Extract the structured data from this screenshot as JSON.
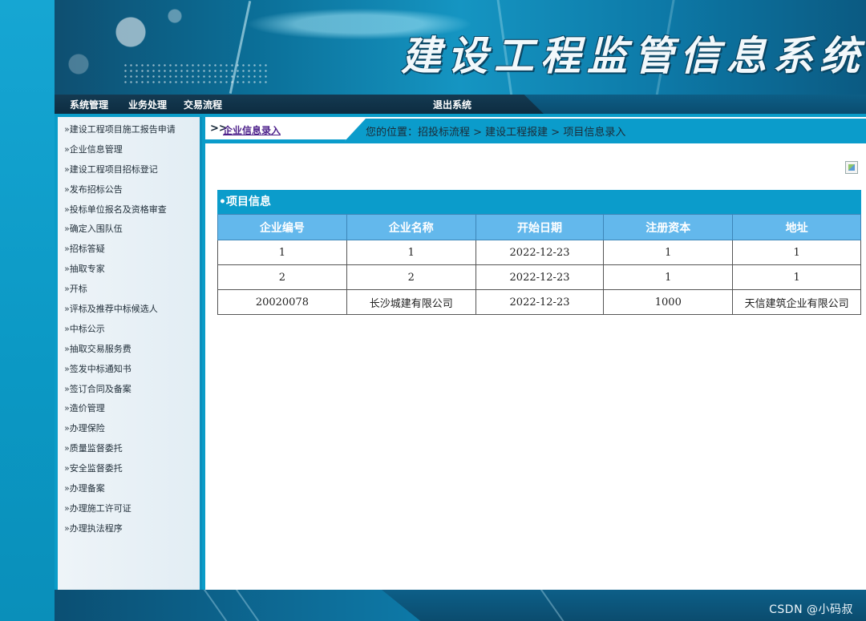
{
  "app": {
    "title": "建设工程监管信息系统"
  },
  "nav": {
    "items": [
      {
        "label": "系统管理"
      },
      {
        "label": "业务处理"
      },
      {
        "label": "交易流程"
      }
    ],
    "logout_label": "退出系统"
  },
  "sidebar": {
    "items": [
      {
        "label": "»建设工程项目施工报告申请"
      },
      {
        "label": "»企业信息管理"
      },
      {
        "label": "»建设工程项目招标登记"
      },
      {
        "label": "»发布招标公告"
      },
      {
        "label": "»投标单位报名及资格审查"
      },
      {
        "label": "»确定入围队伍"
      },
      {
        "label": "»招标答疑"
      },
      {
        "label": "»抽取专家"
      },
      {
        "label": "»开标"
      },
      {
        "label": "»评标及推荐中标候选人"
      },
      {
        "label": "»中标公示"
      },
      {
        "label": "»抽取交易服务费"
      },
      {
        "label": "»签发中标通知书"
      },
      {
        "label": "»签订合同及备案"
      },
      {
        "label": "»造价管理"
      },
      {
        "label": "»办理保险"
      },
      {
        "label": "»质量监督委托"
      },
      {
        "label": "»安全监督委托"
      },
      {
        "label": "»办理备案"
      },
      {
        "label": "»办理施工许可证"
      },
      {
        "label": "»办理执法程序"
      }
    ]
  },
  "breadcrumb": {
    "arrows": ">>",
    "tab_label": "企业信息录入",
    "path": "您的位置：招投标流程 > 建设工程报建 > 项目信息录入"
  },
  "section": {
    "title": "•项目信息"
  },
  "table": {
    "headers": [
      "企业编号",
      "企业名称",
      "开始日期",
      "注册资本",
      "地址"
    ],
    "rows": [
      [
        "1",
        "1",
        "2022-12-23",
        "1",
        "1"
      ],
      [
        "2",
        "2",
        "2022-12-23",
        "1",
        "1"
      ],
      [
        "20020078",
        "长沙城建有限公司",
        "2022-12-23",
        "1000",
        "天信建筑企业有限公司"
      ]
    ]
  },
  "watermark": "CSDN @小码叔",
  "colors": {
    "accent": "#0b9ccb",
    "header_cell": "#63b8ec",
    "tab_link": "#4c1f8a"
  }
}
